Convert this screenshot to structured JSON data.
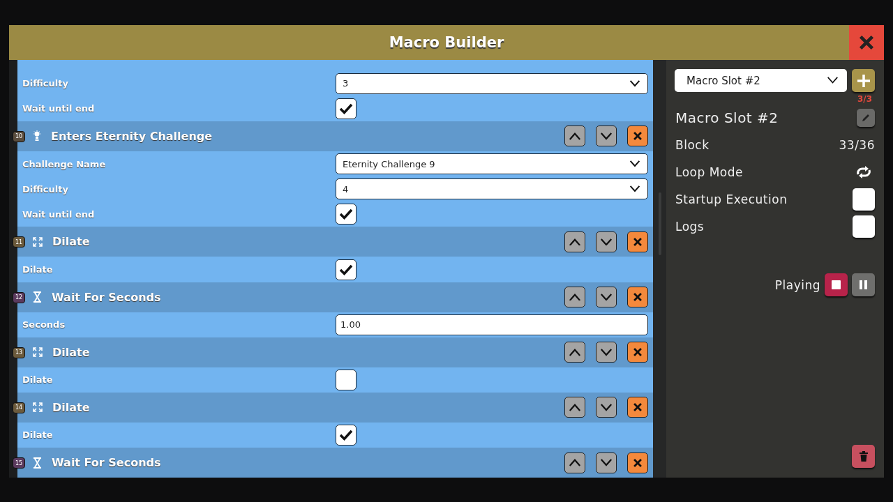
{
  "window": {
    "title": "Macro Builder"
  },
  "blocks": [
    {
      "fields": [
        {
          "kind": "select",
          "label": "Difficulty",
          "value": "3"
        },
        {
          "kind": "checkbox",
          "label": "Wait until end",
          "checked": true
        }
      ]
    },
    {
      "number": "10",
      "color": "#5a4d3e",
      "kind": "bulb",
      "title": "Enters Eternity Challenge",
      "fields": [
        {
          "kind": "select",
          "label": "Challenge Name",
          "value": "Eternity Challenge 9"
        },
        {
          "kind": "select",
          "label": "Difficulty",
          "value": "4"
        },
        {
          "kind": "checkbox",
          "label": "Wait until end",
          "checked": true
        }
      ]
    },
    {
      "number": "11",
      "color": "#6b5a3c",
      "kind": "dilate",
      "title": "Dilate",
      "fields": [
        {
          "kind": "checkbox",
          "label": "Dilate",
          "checked": true
        }
      ]
    },
    {
      "number": "12",
      "color": "#5b3a5e",
      "kind": "wait",
      "title": "Wait For Seconds",
      "fields": [
        {
          "kind": "number",
          "label": "Seconds",
          "value": "1.00"
        }
      ]
    },
    {
      "number": "13",
      "color": "#6b5a3c",
      "kind": "dilate",
      "title": "Dilate",
      "fields": [
        {
          "kind": "checkbox",
          "label": "Dilate",
          "checked": false
        }
      ]
    },
    {
      "number": "14",
      "color": "#6b5a3c",
      "kind": "dilate",
      "title": "Dilate",
      "fields": [
        {
          "kind": "checkbox",
          "label": "Dilate",
          "checked": true
        }
      ]
    },
    {
      "number": "15",
      "color": "#5b3a5e",
      "kind": "wait",
      "title": "Wait For Seconds"
    }
  ],
  "sidebar": {
    "slot_select": "Macro Slot #2",
    "slot_count": "3/3",
    "slot_name": "Macro Slot #2",
    "block_label": "Block",
    "block_value": "33/36",
    "loop_label": "Loop Mode",
    "options": [
      {
        "label": "Startup Execution",
        "checked": false
      },
      {
        "label": "Logs",
        "checked": false
      }
    ],
    "status": "Playing"
  }
}
